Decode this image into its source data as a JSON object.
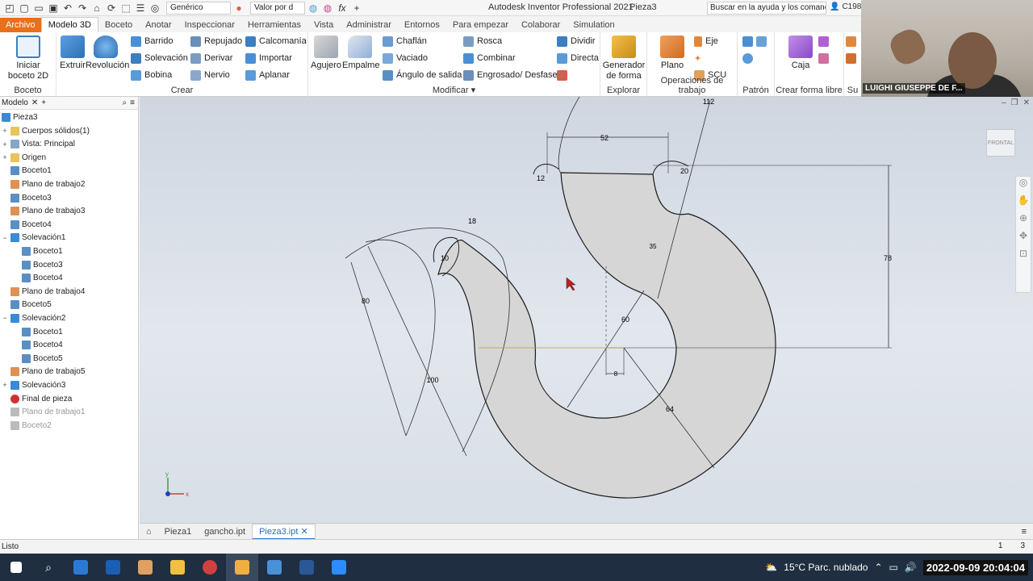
{
  "titlebar": {
    "app_title": "Autodesk Inventor Professional 2021",
    "doc_title": "Pieza3",
    "material_select": "Genérico",
    "appearance_select": "Valor por d",
    "help_search": "Buscar en la ayuda y los comanc",
    "user": "C198"
  },
  "ribbon_tabs": [
    "Archivo",
    "Modelo 3D",
    "Boceto",
    "Anotar",
    "Inspeccionar",
    "Herramientas",
    "Vista",
    "Administrar",
    "Entornos",
    "Para empezar",
    "Colaborar",
    "Simulation"
  ],
  "active_tab": "Modelo 3D",
  "ribbon": {
    "boceto": {
      "label": "Boceto",
      "start_sketch": "Iniciar boceto 2D"
    },
    "crear": {
      "label": "Crear",
      "extruir": "Extruir",
      "revolucion": "Revolución",
      "col1": [
        "Barrido",
        "Solevación",
        "Bobina"
      ],
      "col2": [
        "Repujado",
        "Derivar",
        "Nervio"
      ],
      "col3": [
        "Calcomanía",
        "Importar",
        "Aplanar"
      ]
    },
    "modificar": {
      "label": "Modificar",
      "agujero": "Agujero",
      "empalme": "Empalme",
      "col1": [
        "Chaflán",
        "Vaciado",
        "Ángulo de salida"
      ],
      "col2": [
        "Rosca",
        "Combinar",
        "Engrosado/ Desfase"
      ],
      "col3": [
        "Dividir",
        "Directa"
      ]
    },
    "explorar": {
      "label": "Explorar",
      "generador": "Generador de forma"
    },
    "operaciones": {
      "label": "Operaciones de trabajo",
      "plano": "Plano",
      "eje": "Eje",
      "scu": "SCU"
    },
    "patron": {
      "label": "Patrón"
    },
    "forma_libre": {
      "label": "Crear forma libre",
      "caja": "Caja"
    },
    "extra": {
      "label": "Su"
    }
  },
  "webcam": {
    "name": "LUIGHI GIUSEPPE DE F..."
  },
  "browser": {
    "tab": "Modelo",
    "root": "Pieza3",
    "items": [
      {
        "label": "Cuerpos sólidos(1)",
        "level": 1,
        "icon": "folder",
        "exp": "+"
      },
      {
        "label": "Vista: Principal",
        "level": 1,
        "icon": "view",
        "exp": "+"
      },
      {
        "label": "Origen",
        "level": 1,
        "icon": "folder",
        "exp": "+"
      },
      {
        "label": "Boceto1",
        "level": 1,
        "icon": "sketch",
        "exp": ""
      },
      {
        "label": "Plano de trabajo2",
        "level": 1,
        "icon": "plane",
        "exp": ""
      },
      {
        "label": "Boceto3",
        "level": 1,
        "icon": "sketch",
        "exp": ""
      },
      {
        "label": "Plano de trabajo3",
        "level": 1,
        "icon": "plane",
        "exp": ""
      },
      {
        "label": "Boceto4",
        "level": 1,
        "icon": "sketch",
        "exp": ""
      },
      {
        "label": "Solevación1",
        "level": 1,
        "icon": "loft",
        "exp": "−"
      },
      {
        "label": "Boceto1",
        "level": 2,
        "icon": "sketch",
        "exp": ""
      },
      {
        "label": "Boceto3",
        "level": 2,
        "icon": "sketch",
        "exp": ""
      },
      {
        "label": "Boceto4",
        "level": 2,
        "icon": "sketch",
        "exp": ""
      },
      {
        "label": "Plano de trabajo4",
        "level": 1,
        "icon": "plane",
        "exp": ""
      },
      {
        "label": "Boceto5",
        "level": 1,
        "icon": "sketch",
        "exp": ""
      },
      {
        "label": "Solevación2",
        "level": 1,
        "icon": "loft",
        "exp": "−"
      },
      {
        "label": "Boceto1",
        "level": 2,
        "icon": "sketch",
        "exp": ""
      },
      {
        "label": "Boceto4",
        "level": 2,
        "icon": "sketch",
        "exp": ""
      },
      {
        "label": "Boceto5",
        "level": 2,
        "icon": "sketch",
        "exp": ""
      },
      {
        "label": "Plano de trabajo5",
        "level": 1,
        "icon": "plane",
        "exp": ""
      },
      {
        "label": "Solevación3",
        "level": 1,
        "icon": "loft",
        "exp": "+"
      },
      {
        "label": "Final de pieza",
        "level": 1,
        "icon": "end",
        "exp": ""
      },
      {
        "label": "Plano de trabajo1",
        "level": 1,
        "icon": "plane-dim",
        "exp": ""
      },
      {
        "label": "Boceto2",
        "level": 1,
        "icon": "sketch-dim",
        "exp": ""
      }
    ]
  },
  "viewport": {
    "viewcube_label": "FRONTAL",
    "dimensions": {
      "d52": "52",
      "d112": "112",
      "d12": "12",
      "d20": "20",
      "d78": "78",
      "d18": "18",
      "d10": "10",
      "d80": "80",
      "d100": "100",
      "d60": "60",
      "d8": "8",
      "d64": "64",
      "d35": "35"
    },
    "axis_x": "x",
    "axis_y": "y"
  },
  "doc_tabs": [
    "Pieza1",
    "gancho.ipt",
    "Pieza3.ipt"
  ],
  "active_doc": "Pieza3.ipt",
  "status": {
    "text": "Listo",
    "n1": "1",
    "n2": "3"
  },
  "taskbar": {
    "weather": "15°C  Parc. nublado",
    "clock": "2022-09-09  20:04:04",
    "clock_small": "20:04"
  },
  "colors": {
    "accent": "#e8701a",
    "taskbar": "#1f2e40",
    "part_fill": "#d8d8d8"
  }
}
